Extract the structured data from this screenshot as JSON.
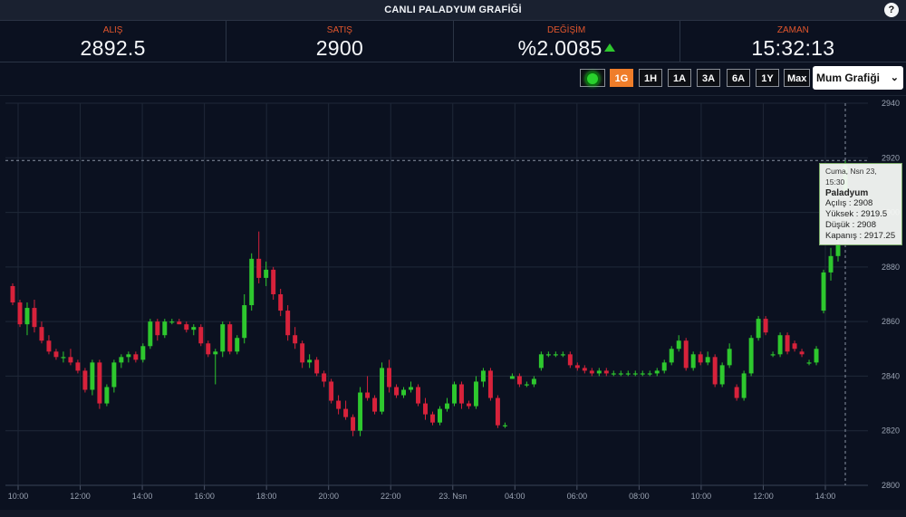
{
  "title": "CANLI PALADYUM GRAFİĞİ",
  "help_icon": "question-icon",
  "stats": [
    {
      "label": "ALIŞ",
      "value": "2892.5"
    },
    {
      "label": "SATIŞ",
      "value": "2900"
    },
    {
      "label": "DEĞİŞİM",
      "value": "%2.0085"
    },
    {
      "label": "ZAMAN",
      "value": "15:32:13"
    }
  ],
  "toolbar": {
    "live_icon": "live-indicator-icon",
    "ranges": [
      "1G",
      "1H",
      "1A",
      "3A",
      "6A",
      "1Y",
      "Max"
    ],
    "active_range": "1G",
    "chart_type": "Mum Grafiği"
  },
  "colors": {
    "up": "#2ec82e",
    "down": "#d7223b",
    "accent": "#ef7d2a",
    "label": "#e2562d"
  },
  "tooltip": {
    "date": "Cuma, Nsn 23, 15:30",
    "name": "Paladyum",
    "open": "Açılış : 2908",
    "high": "Yüksek : 2919.5",
    "low": "Düşük : 2908",
    "close": "Kapanış : 2917.25"
  },
  "crosshair_value": 2919,
  "chart_data": {
    "type": "candlestick",
    "ylim": [
      2800,
      2940
    ],
    "y_ticks": [
      2800,
      2820,
      2840,
      2860,
      2880,
      2900,
      2920,
      2940
    ],
    "x_ticks": [
      {
        "label": "10:00",
        "t": 0
      },
      {
        "label": "12:00",
        "t": 2
      },
      {
        "label": "14:00",
        "t": 4
      },
      {
        "label": "16:00",
        "t": 6
      },
      {
        "label": "18:00",
        "t": 8
      },
      {
        "label": "20:00",
        "t": 10
      },
      {
        "label": "22:00",
        "t": 12
      },
      {
        "label": "23. Nsn",
        "t": 14
      },
      {
        "label": "04:00",
        "t": 16
      },
      {
        "label": "06:00",
        "t": 18
      },
      {
        "label": "08:00",
        "t": 20
      },
      {
        "label": "10:00",
        "t": 22
      },
      {
        "label": "12:00",
        "t": 24
      },
      {
        "label": "14:00",
        "t": 26
      }
    ],
    "candles": [
      [
        2873,
        2874,
        2866,
        2867
      ],
      [
        2867,
        2868,
        2858,
        2859
      ],
      [
        2859,
        2867,
        2855,
        2865
      ],
      [
        2865,
        2868,
        2856,
        2858
      ],
      [
        2858,
        2860,
        2852,
        2853
      ],
      [
        2853,
        2855,
        2848,
        2849
      ],
      [
        2849,
        2850,
        2846,
        2847
      ],
      [
        2847,
        2849,
        2845,
        2847
      ],
      [
        2847,
        2850,
        2844,
        2845
      ],
      [
        2845,
        2846,
        2841,
        2842
      ],
      [
        2842,
        2843,
        2834,
        2835
      ],
      [
        2835,
        2846,
        2833,
        2845
      ],
      [
        2845,
        2846,
        2828,
        2830
      ],
      [
        2830,
        2837,
        2829,
        2836
      ],
      [
        2836,
        2846,
        2834,
        2845
      ],
      [
        2845,
        2848,
        2843,
        2847
      ],
      [
        2847,
        2849,
        2845,
        2848
      ],
      [
        2848,
        2849,
        2845,
        2846
      ],
      [
        2846,
        2852,
        2845,
        2851
      ],
      [
        2851,
        2861,
        2850,
        2860
      ],
      [
        2860,
        2861,
        2853,
        2855
      ],
      [
        2855,
        2861,
        2854,
        2860
      ],
      [
        2860,
        2861,
        2859,
        2860
      ],
      [
        2860,
        2861,
        2859,
        2859
      ],
      [
        2859,
        2860,
        2856,
        2857
      ],
      [
        2857,
        2859,
        2855,
        2858
      ],
      [
        2858,
        2859,
        2851,
        2852
      ],
      [
        2852,
        2853,
        2847,
        2848
      ],
      [
        2848,
        2850,
        2837,
        2849
      ],
      [
        2849,
        2860,
        2847,
        2859
      ],
      [
        2859,
        2860,
        2848,
        2849
      ],
      [
        2849,
        2855,
        2848,
        2854
      ],
      [
        2854,
        2870,
        2852,
        2866
      ],
      [
        2866,
        2885,
        2864,
        2883
      ],
      [
        2883,
        2893,
        2874,
        2876
      ],
      [
        2876,
        2882,
        2873,
        2879
      ],
      [
        2879,
        2880,
        2868,
        2870
      ],
      [
        2870,
        2872,
        2862,
        2864
      ],
      [
        2864,
        2866,
        2853,
        2855
      ],
      [
        2855,
        2858,
        2850,
        2852
      ],
      [
        2852,
        2853,
        2843,
        2845
      ],
      [
        2845,
        2848,
        2843,
        2846
      ],
      [
        2846,
        2847,
        2840,
        2841
      ],
      [
        2841,
        2842,
        2836,
        2838
      ],
      [
        2838,
        2839,
        2830,
        2831
      ],
      [
        2831,
        2833,
        2826,
        2828
      ],
      [
        2828,
        2831,
        2824,
        2825
      ],
      [
        2825,
        2826,
        2818,
        2820
      ],
      [
        2820,
        2836,
        2818,
        2834
      ],
      [
        2834,
        2840,
        2831,
        2832
      ],
      [
        2832,
        2833,
        2826,
        2827
      ],
      [
        2827,
        2845,
        2826,
        2843
      ],
      [
        2843,
        2846,
        2834,
        2836
      ],
      [
        2836,
        2837,
        2832,
        2833
      ],
      [
        2833,
        2836,
        2832,
        2835
      ],
      [
        2835,
        2838,
        2834,
        2836
      ],
      [
        2836,
        2837,
        2829,
        2830
      ],
      [
        2830,
        2832,
        2824,
        2826
      ],
      [
        2826,
        2827,
        2822,
        2823
      ],
      [
        2823,
        2829,
        2822,
        2828
      ],
      [
        2828,
        2832,
        2827,
        2830
      ],
      [
        2830,
        2838,
        2829,
        2837
      ],
      [
        2837,
        2838,
        2828,
        2830
      ],
      [
        2830,
        2831,
        2828,
        2829
      ],
      [
        2829,
        2840,
        2828,
        2838
      ],
      [
        2838,
        2843,
        2836,
        2842
      ],
      [
        2842,
        2843,
        2831,
        2832
      ],
      [
        2832,
        2833,
        2821,
        2822
      ],
      [
        2822,
        2823,
        2821,
        2822
      ],
      [
        2839,
        2841,
        2839,
        2840
      ],
      [
        2840,
        2841,
        2836,
        2837
      ],
      [
        2837,
        2838,
        2836,
        2837
      ],
      [
        2837,
        2840,
        2836,
        2839
      ],
      [
        2843,
        2849,
        2842,
        2848
      ],
      [
        2848,
        2849,
        2847,
        2848
      ],
      [
        2848,
        2849,
        2847,
        2848
      ],
      [
        2848,
        2849,
        2847,
        2848
      ],
      [
        2848,
        2849,
        2843,
        2844
      ],
      [
        2844,
        2845,
        2842,
        2843
      ],
      [
        2843,
        2844,
        2841,
        2842
      ],
      [
        2842,
        2843,
        2840,
        2841
      ],
      [
        2841,
        2843,
        2840,
        2842
      ],
      [
        2842,
        2843,
        2840,
        2841
      ],
      [
        2841,
        2842,
        2840,
        2841
      ],
      [
        2841,
        2842,
        2840,
        2841
      ],
      [
        2841,
        2842,
        2840,
        2841
      ],
      [
        2841,
        2842,
        2840,
        2841
      ],
      [
        2841,
        2842,
        2840,
        2841
      ],
      [
        2841,
        2842,
        2840,
        2841
      ],
      [
        2841,
        2843,
        2840,
        2842
      ],
      [
        2842,
        2846,
        2841,
        2845
      ],
      [
        2845,
        2851,
        2844,
        2850
      ],
      [
        2850,
        2855,
        2849,
        2853
      ],
      [
        2853,
        2854,
        2842,
        2843
      ],
      [
        2843,
        2849,
        2842,
        2848
      ],
      [
        2848,
        2849,
        2844,
        2845
      ],
      [
        2845,
        2849,
        2844,
        2847
      ],
      [
        2847,
        2848,
        2836,
        2837
      ],
      [
        2837,
        2845,
        2836,
        2844
      ],
      [
        2844,
        2852,
        2843,
        2850
      ],
      [
        2836,
        2837,
        2831,
        2832
      ],
      [
        2832,
        2842,
        2831,
        2841
      ],
      [
        2841,
        2855,
        2840,
        2854
      ],
      [
        2854,
        2862,
        2853,
        2861
      ],
      [
        2861,
        2862,
        2855,
        2856
      ],
      [
        2848,
        2849,
        2847,
        2848
      ],
      [
        2848,
        2856,
        2847,
        2855
      ],
      [
        2855,
        2856,
        2848,
        2849
      ],
      [
        2852,
        2853,
        2849,
        2850
      ],
      [
        2849,
        2850,
        2847,
        2848
      ],
      [
        2845,
        2846,
        2844,
        2845
      ],
      [
        2845,
        2851,
        2844,
        2850
      ],
      [
        2864,
        2879,
        2863,
        2878
      ],
      [
        2878,
        2887,
        2875,
        2884
      ],
      [
        2884,
        2890,
        2882,
        2888
      ],
      [
        2908,
        2919.5,
        2908,
        2917.25
      ]
    ]
  }
}
